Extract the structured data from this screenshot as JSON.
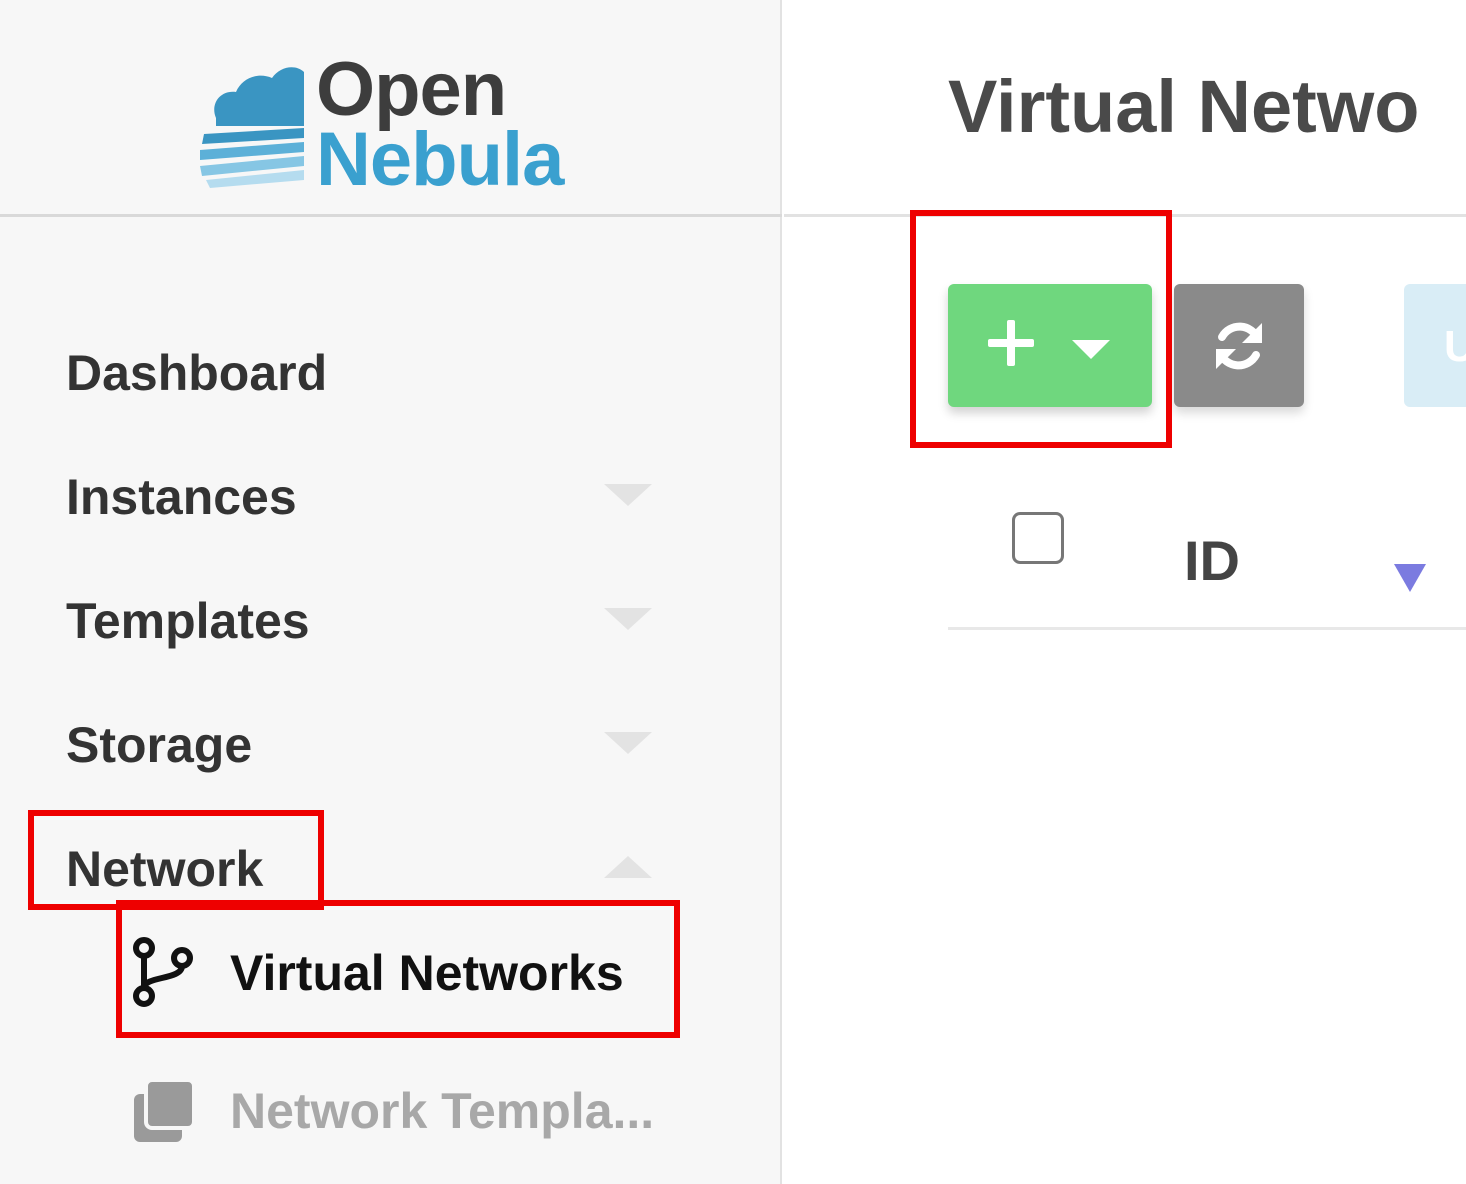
{
  "logo": {
    "line1": "Open",
    "line2": "Nebula"
  },
  "sidebar": {
    "items": [
      {
        "label": "Dashboard",
        "has_caret": false
      },
      {
        "label": "Instances",
        "has_caret": true,
        "expanded": false
      },
      {
        "label": "Templates",
        "has_caret": true,
        "expanded": false
      },
      {
        "label": "Storage",
        "has_caret": true,
        "expanded": false
      },
      {
        "label": "Network",
        "has_caret": true,
        "expanded": true
      }
    ],
    "network_subitems": [
      {
        "label": "Virtual Networks",
        "icon": "git-branch-icon",
        "active": true
      },
      {
        "label": "Network Templa...",
        "icon": "stacked-layers-icon",
        "active": false
      }
    ]
  },
  "main": {
    "title": "Virtual Netwo",
    "toolbar": {
      "partial_button_label": "U"
    },
    "table": {
      "columns": [
        "ID"
      ]
    }
  },
  "colors": {
    "create_button": "#6fd77e",
    "refresh_button": "#8a8a8a",
    "highlight": "#ee0000",
    "brand_blue": "#3aa0cf",
    "sort_indicator": "#7b7be0"
  }
}
